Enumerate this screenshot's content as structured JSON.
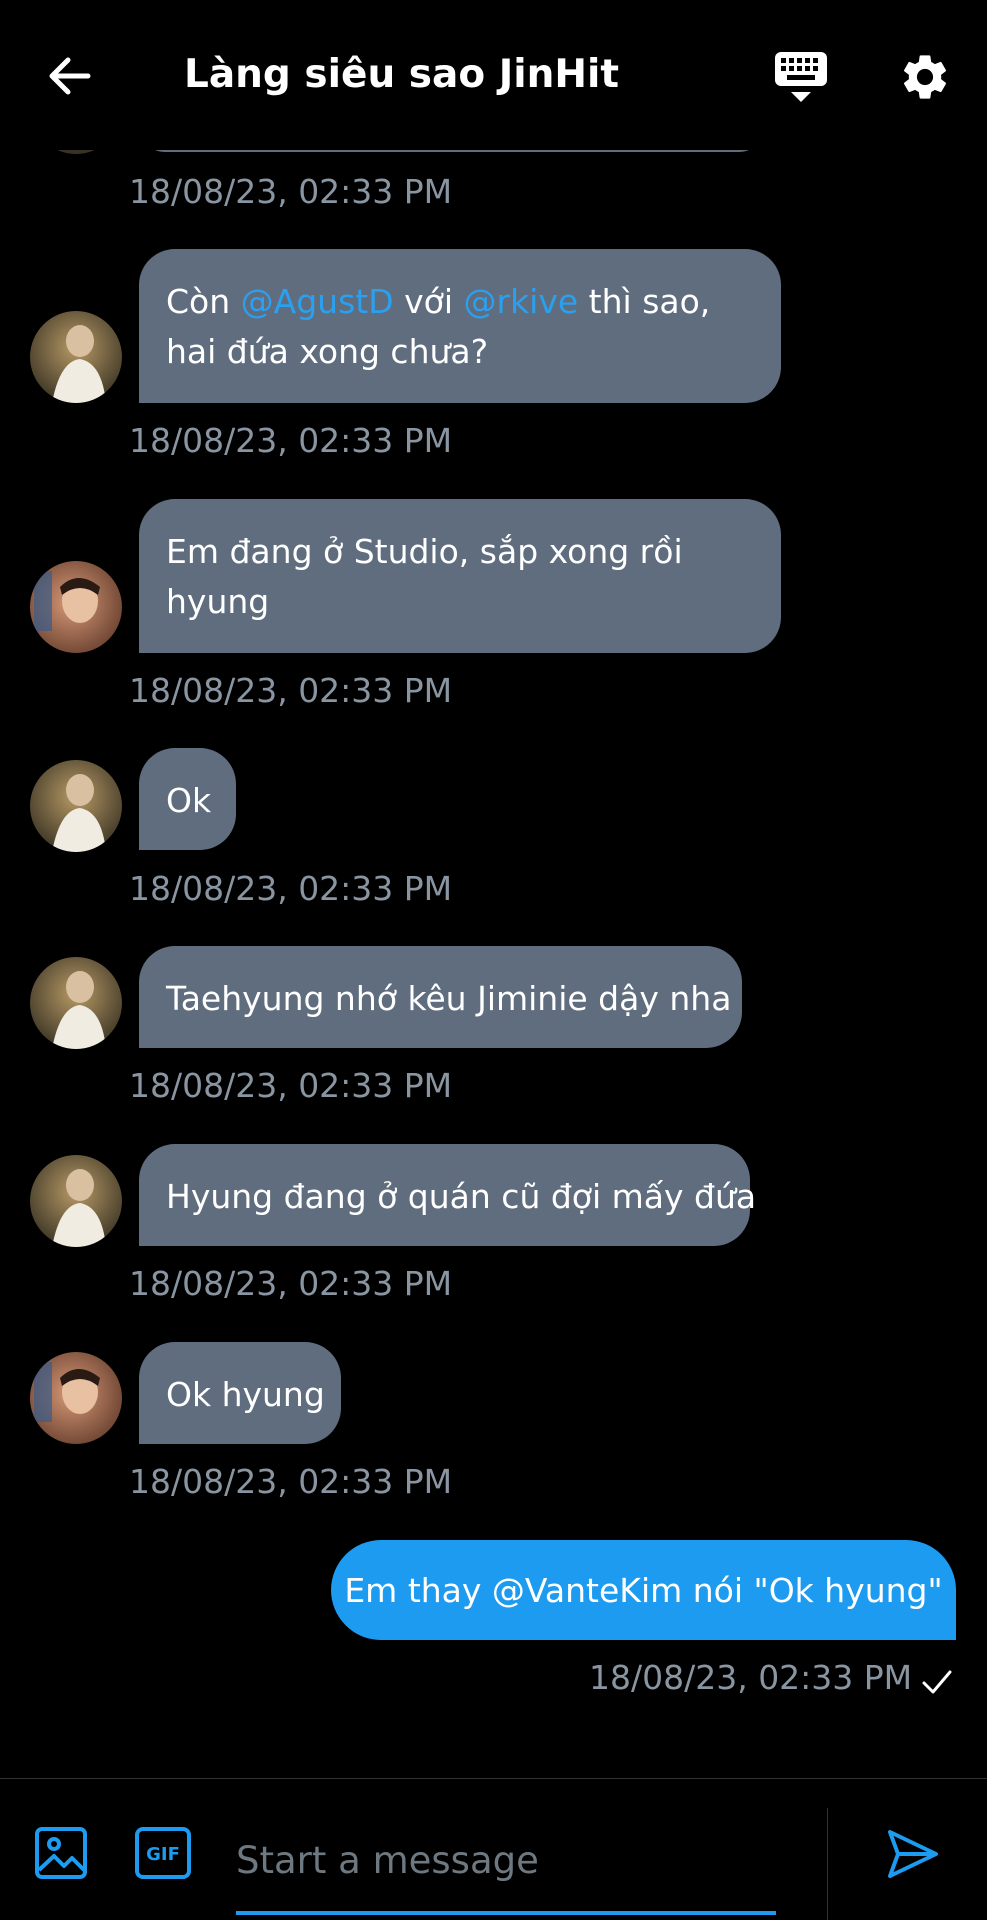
{
  "header": {
    "title": "Làng siêu sao JinHit",
    "back_icon": "arrow-left-icon",
    "keyboard_icon": "keyboard-icon",
    "settings_icon": "gear-icon"
  },
  "colors": {
    "background": "#000000",
    "incoming_bubble": "#5f6d7e",
    "outgoing_bubble": "#1d9bf0",
    "mention": "#2aa0ef",
    "timestamp": "#8a95a2",
    "accent": "#1d9bf0"
  },
  "messages": [
    {
      "sender": "jin",
      "parts": [
        "Còn ",
        "@AgustD",
        " với ",
        "@rkive",
        " thì sao, hai đứa xong chưa?"
      ],
      "time": "18/08/23, 02:33 PM"
    },
    {
      "sender": "vante",
      "text": "Em đang ở Studio, sắp xong rồi hyung",
      "time": "18/08/23, 02:33 PM"
    },
    {
      "sender": "jin",
      "text": "Ok",
      "time": "18/08/23, 02:33 PM"
    },
    {
      "sender": "jin",
      "text": "Taehyung nhớ kêu Jiminie dậy nha",
      "time": "18/08/23, 02:33 PM"
    },
    {
      "sender": "jin",
      "text": "Hyung đang ở quán cũ đợi mấy đứa",
      "time": "18/08/23, 02:33 PM"
    },
    {
      "sender": "vante",
      "text": "Ok hyung",
      "time": "18/08/23, 02:33 PM"
    },
    {
      "sender": "me",
      "text": "Em thay @VanteKim nói \"Ok hyung\"",
      "time": "18/08/23, 02:33 PM",
      "status_icon": "checkmark-icon"
    }
  ],
  "partial_time": "18/08/23, 02:33 PM",
  "composer": {
    "placeholder": "Start a message",
    "media_icon": "image-icon",
    "gif_label": "GIF",
    "send_icon": "send-icon"
  }
}
